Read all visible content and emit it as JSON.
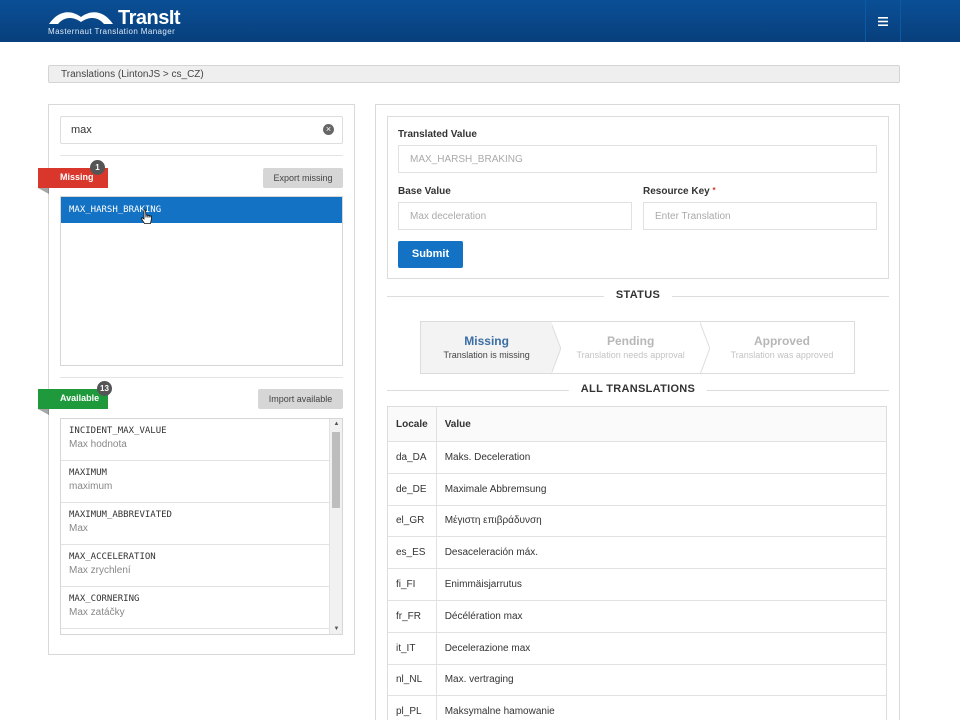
{
  "header": {
    "logo_word": "TransIt",
    "logo_subtitle": "Masternaut Translation Manager",
    "menu_icon": "hamburger-icon"
  },
  "breadcrumb": "Translations (LintonJS > cs_CZ)",
  "search": {
    "value": "max",
    "clear_icon": "clear-icon"
  },
  "missing": {
    "label": "Missing",
    "count": "1",
    "export_label": "Export missing",
    "items": [
      "MAX_HARSH_BRAKING"
    ]
  },
  "available": {
    "label": "Available",
    "count": "13",
    "import_label": "Import available",
    "items": [
      {
        "key": "INCIDENT_MAX_VALUE",
        "value": "Max hodnota"
      },
      {
        "key": "MAXIMUM",
        "value": "maximum"
      },
      {
        "key": "MAXIMUM_ABBREVIATED",
        "value": "Max"
      },
      {
        "key": "MAX_ACCELERATION",
        "value": "Max zrychlení"
      },
      {
        "key": "MAX_CORNERING",
        "value": "Max zatáčky"
      }
    ]
  },
  "form": {
    "translated_label": "Translated Value",
    "translated_value": "MAX_HARSH_BRAKING",
    "base_label": "Base Value",
    "base_value": "Max deceleration",
    "resource_label": "Resource Key",
    "required_mark": "*",
    "resource_placeholder": "Enter Translation",
    "submit_label": "Submit"
  },
  "status": {
    "title": "STATUS",
    "steps": [
      {
        "title": "Missing",
        "sub": "Translation is missing"
      },
      {
        "title": "Pending",
        "sub": "Translation needs approval"
      },
      {
        "title": "Approved",
        "sub": "Translation was approved"
      }
    ]
  },
  "all_translations": {
    "title": "ALL TRANSLATIONS",
    "columns": [
      "Locale",
      "Value"
    ],
    "rows": [
      {
        "locale": "da_DA",
        "value": "Maks. Deceleration"
      },
      {
        "locale": "de_DE",
        "value": "Maximale Abbremsung"
      },
      {
        "locale": "el_GR",
        "value": "Μέγιστη επιβράδυνση"
      },
      {
        "locale": "es_ES",
        "value": "Desaceleración máx."
      },
      {
        "locale": "fi_FI",
        "value": "Enimmäisjarrutus"
      },
      {
        "locale": "fr_FR",
        "value": "Décélération max"
      },
      {
        "locale": "it_IT",
        "value": "Decelerazione max"
      },
      {
        "locale": "nl_NL",
        "value": "Max. vertraging"
      },
      {
        "locale": "pl_PL",
        "value": "Maksymalne hamowanie"
      }
    ]
  },
  "colors": {
    "header": "#0a4f96",
    "accent": "#1372c4",
    "missing": "#d9372b",
    "available": "#1e9a3c"
  }
}
